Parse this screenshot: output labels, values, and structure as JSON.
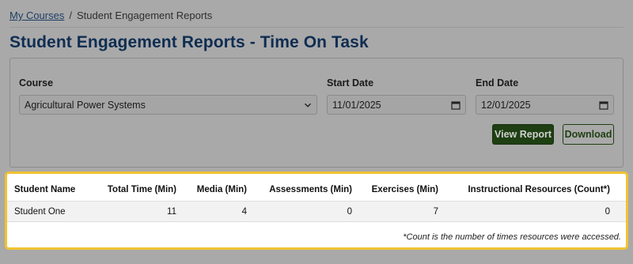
{
  "breadcrumb": {
    "home_label": "My Courses",
    "separator": "/",
    "current": "Student Engagement Reports"
  },
  "page": {
    "title": "Student Engagement Reports - Time On Task"
  },
  "filters": {
    "course": {
      "label": "Course",
      "value": "Agricultural Power Systems",
      "icon": "chevron-down-icon"
    },
    "start_date": {
      "label": "Start Date",
      "value": "11/01/2025",
      "icon": "calendar-icon"
    },
    "end_date": {
      "label": "End Date",
      "value": "12/01/2025",
      "icon": "calendar-icon"
    },
    "view_report_label": "View Report",
    "download_label": "Download"
  },
  "report": {
    "columns": [
      "Student Name",
      "Total Time (Min)",
      "Media (Min)",
      "Assessments (Min)",
      "Exercises (Min)",
      "Instructional Resources (Count*)"
    ],
    "rows": [
      [
        "Student One",
        "11",
        "4",
        "0",
        "7",
        "0"
      ]
    ],
    "footnote": "*Count is the number of times resources were accessed."
  },
  "colors": {
    "highlight_border": "#f1c232",
    "title": "#0f2d52",
    "primary_button": "#1e3f12"
  }
}
